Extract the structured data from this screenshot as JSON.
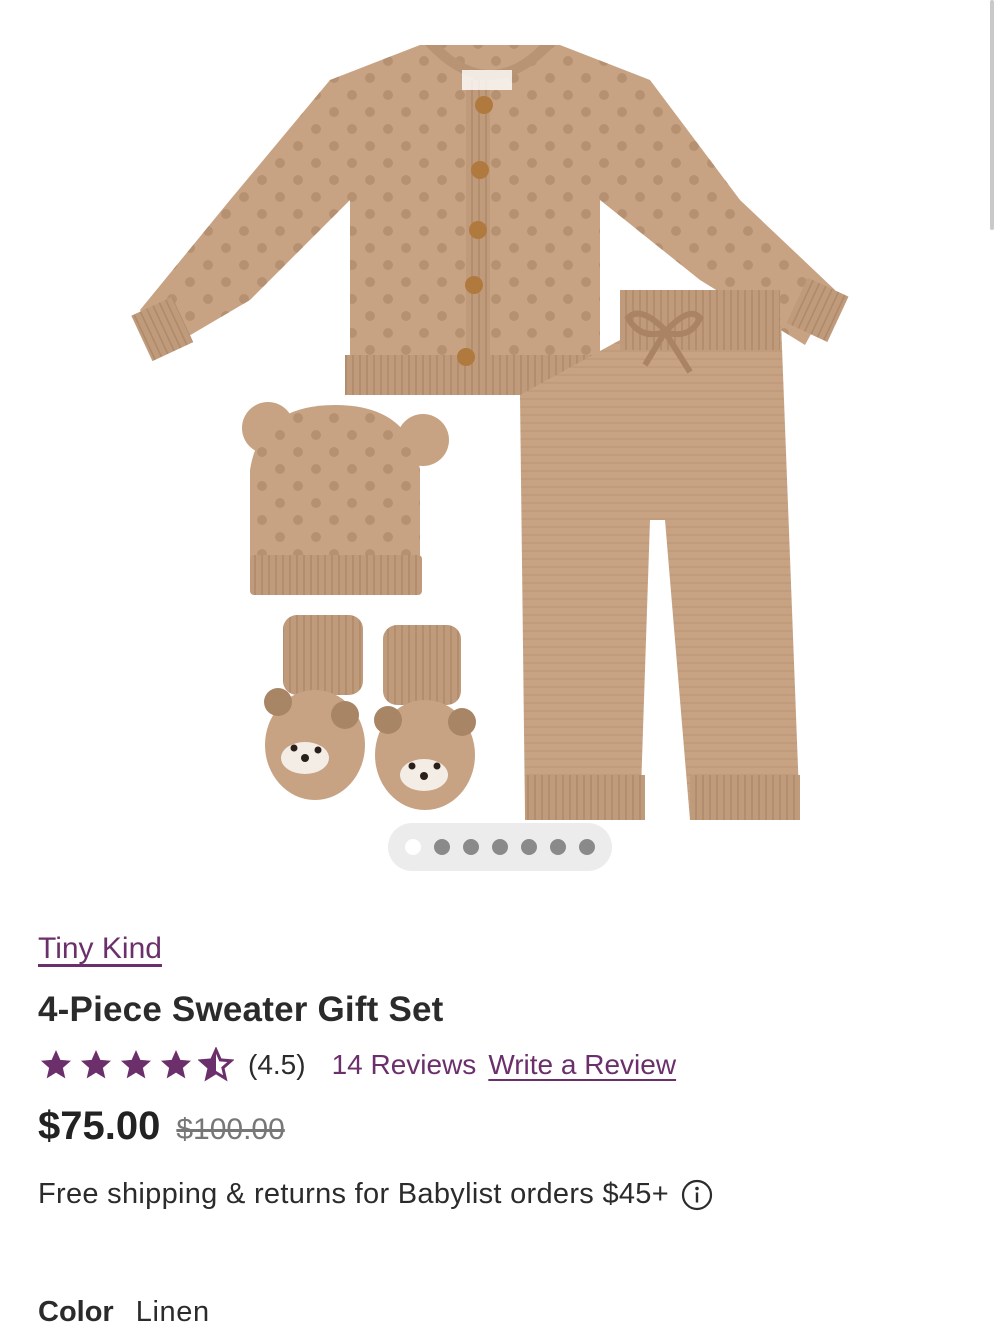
{
  "product": {
    "brand": "Tiny Kind",
    "title": "4-Piece Sweater Gift Set",
    "rating": "(4.5)",
    "rating_value": 4.5,
    "reviews_label": "14 Reviews",
    "write_review_label": "Write a Review",
    "price": "$75.00",
    "original_price": "$100.00",
    "shipping_text": "Free shipping & returns for Babylist orders $45+",
    "color_label": "Color",
    "color_value": "Linen",
    "carousel": {
      "total_images": 7,
      "active_index": 0
    }
  },
  "colors": {
    "accent": "#6b2f6b",
    "knit": "#c6a282",
    "text": "#2b2b2b"
  },
  "icons": {
    "star": "star-icon",
    "half_star": "star-half-icon",
    "info": "info-icon"
  }
}
